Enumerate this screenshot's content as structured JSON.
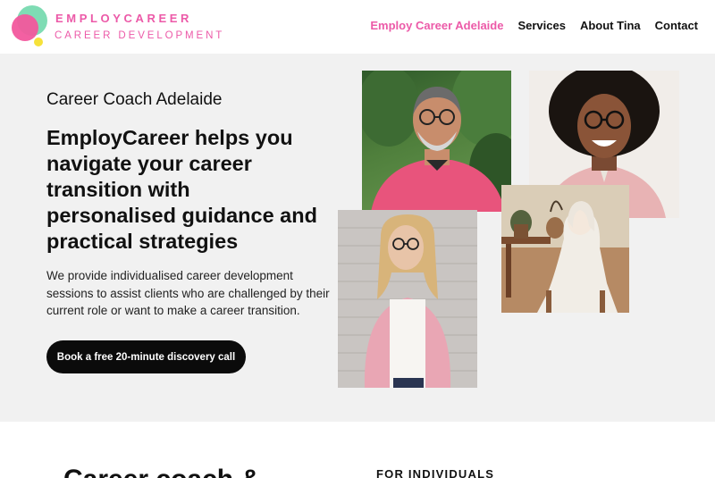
{
  "brand": {
    "name": "EMPLOYCAREER",
    "tagline": "CAREER DEVELOPMENT",
    "colors": {
      "pink": "#ec5aa8",
      "green": "#7fdcb4",
      "yellow": "#f6e23a"
    }
  },
  "nav": {
    "items": [
      {
        "label": "Employ Career Adelaide",
        "active": true
      },
      {
        "label": "Services",
        "active": false
      },
      {
        "label": "About Tina",
        "active": false
      },
      {
        "label": "Contact",
        "active": false
      }
    ]
  },
  "hero": {
    "subtitle": "Career Coach Adelaide",
    "title": "EmployCareer helps you navigate your career transition with personalised guidance and practical strategies",
    "description": "We provide individualised career development sessions to assist clients who are challenged by their current role or want to make a career transition.",
    "cta_label": "Book a free 20-minute discovery call"
  },
  "lower": {
    "title": "Career coach &",
    "label": "FOR INDIVIDUALS"
  }
}
